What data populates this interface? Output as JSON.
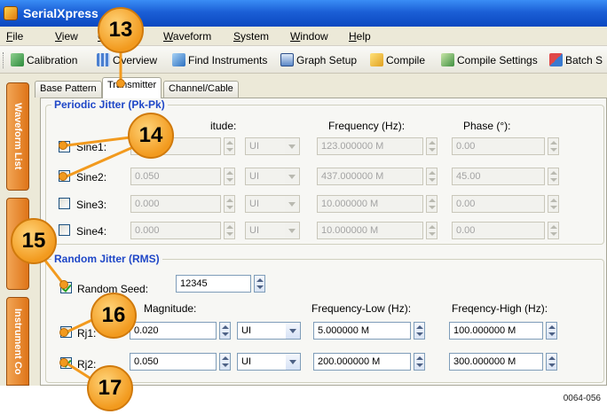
{
  "window": {
    "title": "SerialXpress"
  },
  "menu": [
    "File",
    "View",
    "Co",
    "Waveform",
    "System",
    "Window",
    "Help"
  ],
  "toolbar": [
    "Calibration",
    "Overview",
    "Find Instruments",
    "Graph Setup",
    "Compile",
    "Compile Settings",
    "Batch S"
  ],
  "sidebar": {
    "tab1": "Waveform List",
    "tab2": "",
    "tab3": "Instrument Co"
  },
  "tabs": [
    "Base Pattern",
    "Transmitter",
    "Channel/Cable"
  ],
  "periodic": {
    "title": "Periodic Jitter (Pk-Pk)",
    "headers": {
      "magnitude": "itude:",
      "frequency": "Frequency (Hz):",
      "phase": "Phase (°):"
    },
    "rows": [
      {
        "label": "Sine1:",
        "magnitude": "",
        "unit": "UI",
        "frequency": "123.000000 M",
        "phase": "0.00"
      },
      {
        "label": "Sine2:",
        "magnitude": "0.050",
        "unit": "UI",
        "frequency": "437.000000 M",
        "phase": "45.00"
      },
      {
        "label": "Sine3:",
        "magnitude": "0.000",
        "unit": "UI",
        "frequency": "10.000000 M",
        "phase": "0.00"
      },
      {
        "label": "Sine4:",
        "magnitude": "0.000",
        "unit": "UI",
        "frequency": "10.000000 M",
        "phase": "0.00"
      }
    ]
  },
  "random": {
    "title": "Random Jitter (RMS)",
    "seed_label": "Random Seed:",
    "seed_value": "12345",
    "headers": {
      "magnitude": "Magnitude:",
      "freq_low": "Frequency-Low (Hz):",
      "freq_high": "Freqency-High (Hz):"
    },
    "rows": [
      {
        "label": "Rj1:",
        "magnitude": "0.020",
        "unit": "UI",
        "freq_low": "5.000000 M",
        "freq_high": "100.000000 M"
      },
      {
        "label": "Rj2:",
        "magnitude": "0.050",
        "unit": "UI",
        "freq_low": "200.000000 M",
        "freq_high": "300.000000 M"
      }
    ]
  },
  "callouts": [
    "13",
    "14",
    "15",
    "16",
    "17"
  ],
  "figure_id": "0064-056"
}
